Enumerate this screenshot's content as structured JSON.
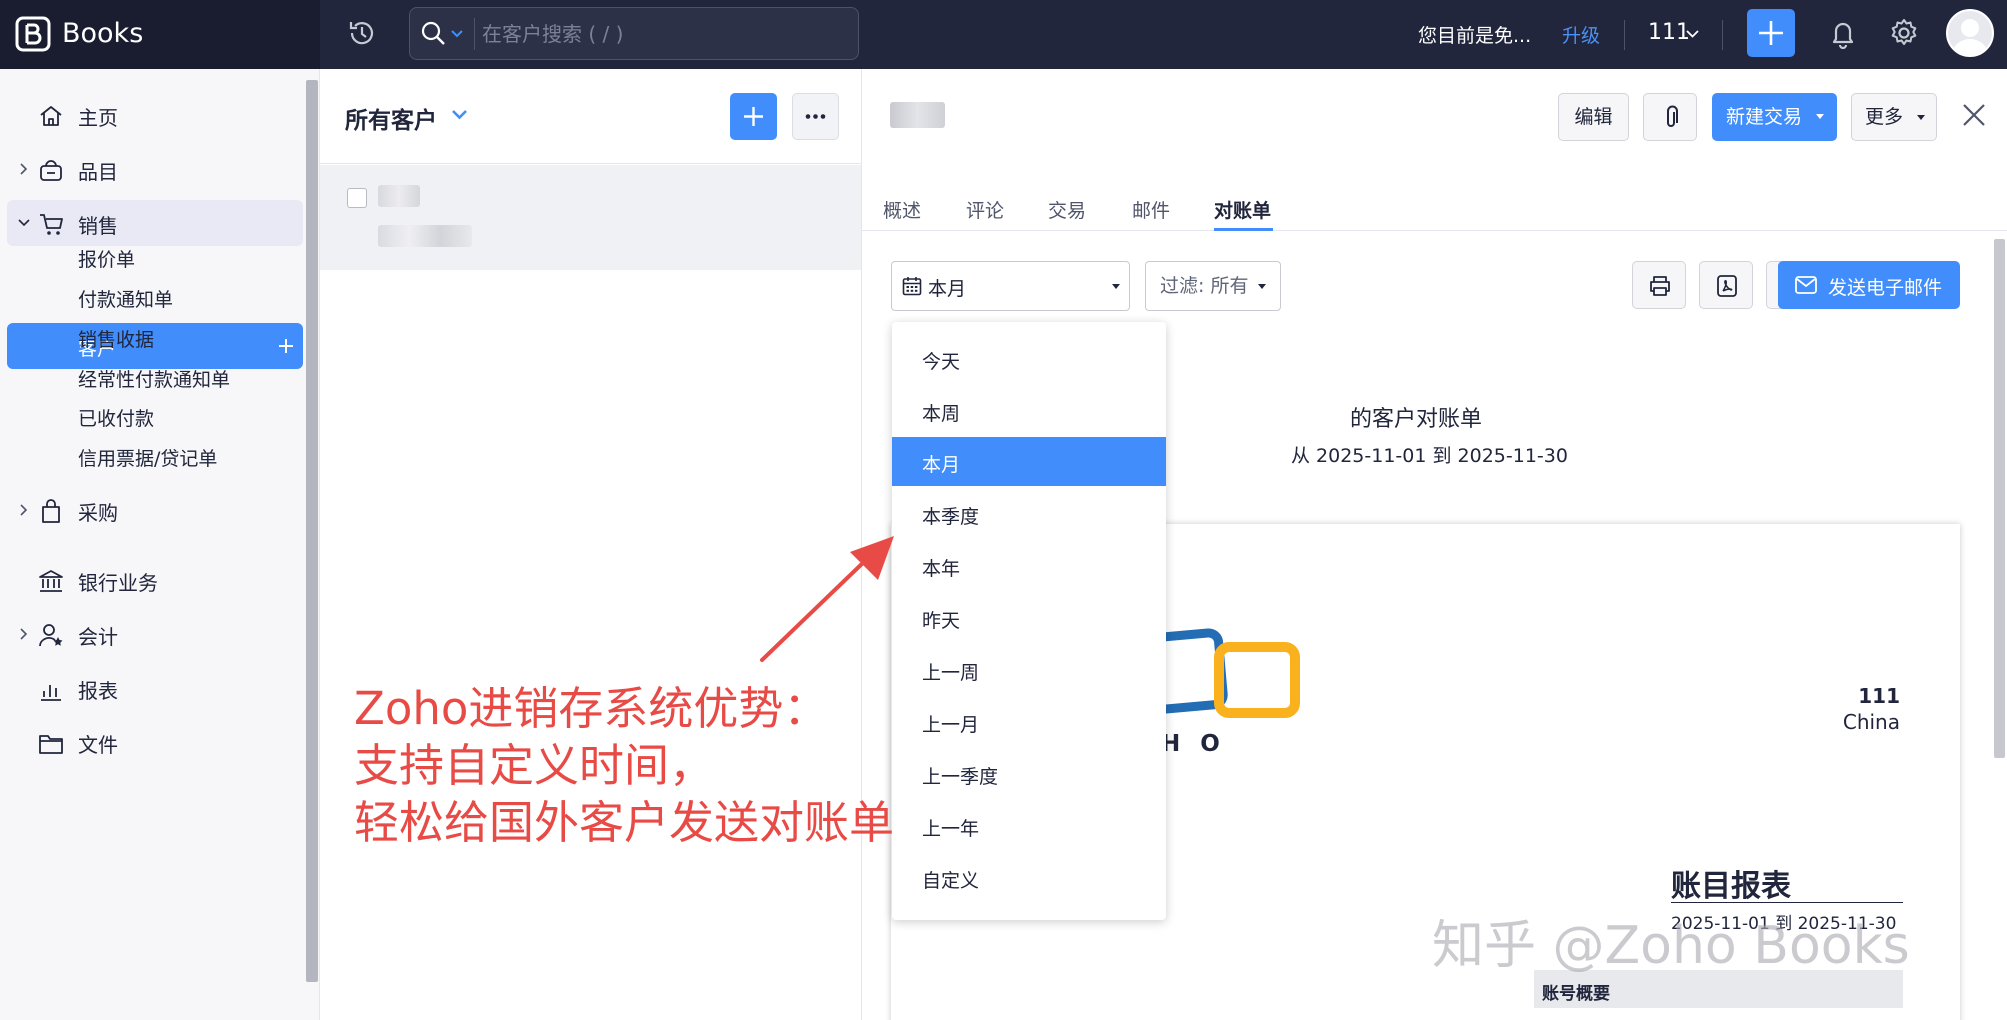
{
  "colors": {
    "topbar": "#21263c",
    "accent": "#408dfb",
    "sidebar_bg": "#f7f7fa",
    "annotation": "#e84a45"
  },
  "topbar": {
    "brand": "Books",
    "search_placeholder": "在客户搜索 ( / )",
    "trial_text": "您目前是免...",
    "upgrade": "升级",
    "org": "111"
  },
  "sidebar": {
    "items": [
      {
        "label": "主页",
        "icon": "home-icon"
      },
      {
        "label": "品目",
        "icon": "basket-icon"
      },
      {
        "label": "销售",
        "icon": "cart-icon"
      },
      {
        "label": "采购",
        "icon": "bag-icon"
      },
      {
        "label": "银行业务",
        "icon": "bank-icon"
      },
      {
        "label": "会计",
        "icon": "accountant-icon"
      },
      {
        "label": "报表",
        "icon": "chart-icon"
      },
      {
        "label": "文件",
        "icon": "folder-icon"
      }
    ],
    "sales_sub": [
      "客户",
      "报价单",
      "付款通知单",
      "销售收据",
      "经常性付款通知单",
      "已收付款",
      "信用票据/贷记单"
    ]
  },
  "list": {
    "title": "所有客户"
  },
  "detail": {
    "buttons": {
      "edit": "编辑",
      "new_transaction": "新建交易",
      "more": "更多"
    },
    "tabs": [
      "概述",
      "评论",
      "交易",
      "邮件",
      "对账单"
    ],
    "date_range": "本月",
    "filter": "过滤: 所有",
    "send_email": "发送电子邮件",
    "statement_title": "的客户对账单",
    "statement_range": "从 2025-11-01 到 2025-11-30",
    "paper": {
      "logo_text": "HO",
      "org": "111",
      "country": "China",
      "report_title": "账目报表",
      "report_range": "2025-11-01 到 2025-11-30",
      "summary_header": "账号概要"
    }
  },
  "dropdown": {
    "options": [
      "今天",
      "本周",
      "本月",
      "本季度",
      "本年",
      "昨天",
      "上一周",
      "上一月",
      "上一季度",
      "上一年",
      "自定义"
    ],
    "selected": "本月"
  },
  "annotation": {
    "lines": [
      "Zoho进销存系统优势：",
      "支持自定义时间，",
      "轻松给国外客户发送对账单"
    ]
  },
  "watermark": "知乎 @Zoho Books"
}
